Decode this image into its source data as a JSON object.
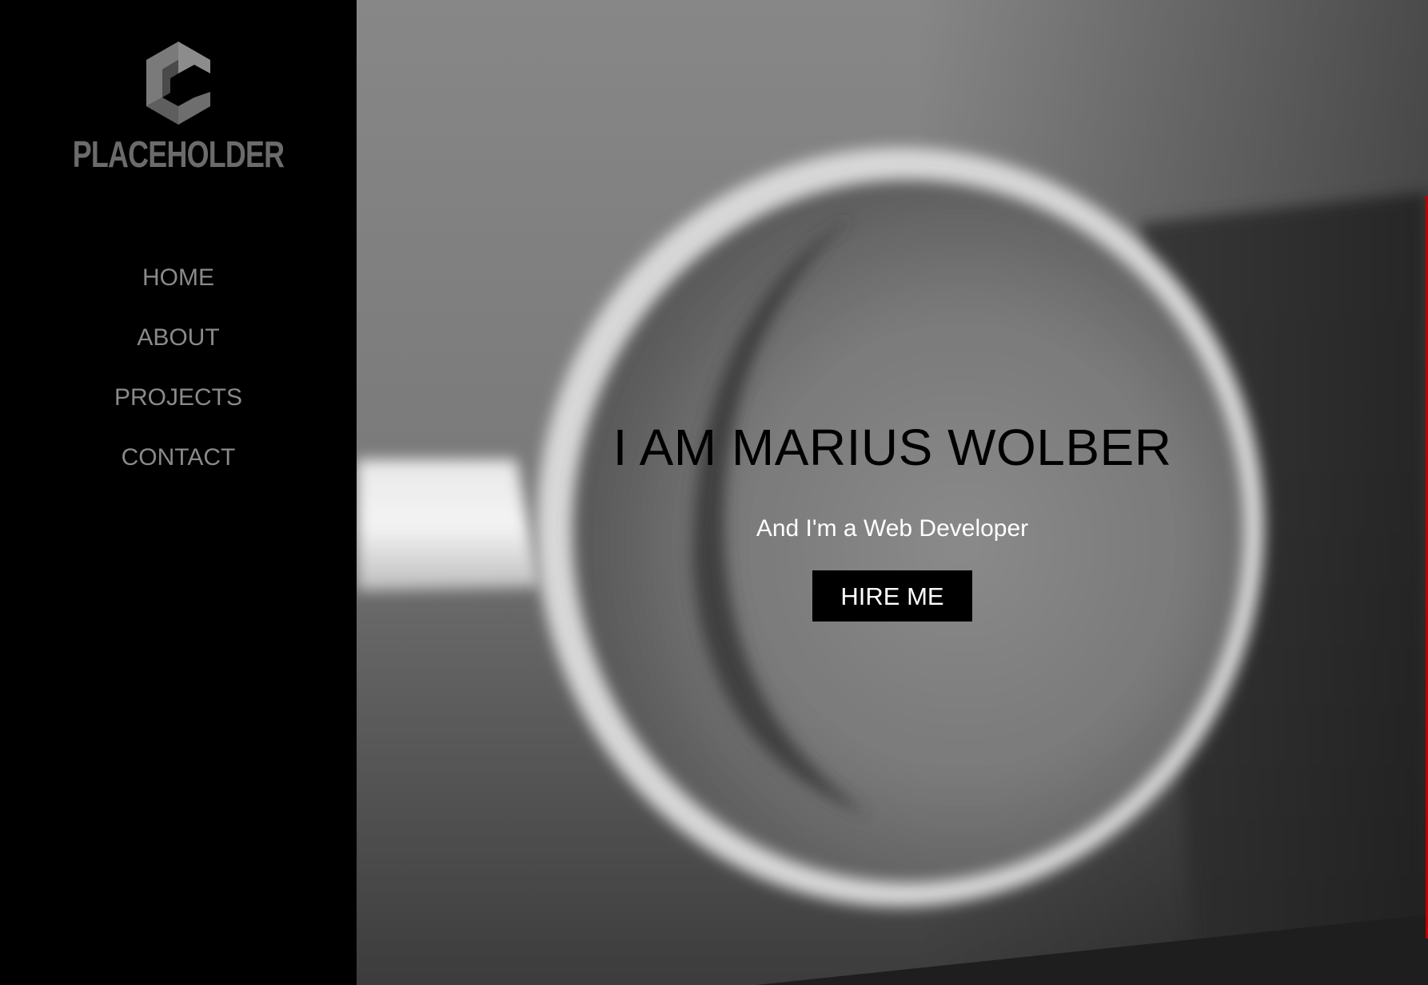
{
  "logo": {
    "text": "PLACEHOLDER"
  },
  "nav": {
    "items": [
      {
        "label": "HOME"
      },
      {
        "label": "ABOUT"
      },
      {
        "label": "PROJECTS"
      },
      {
        "label": "CONTACT"
      }
    ]
  },
  "hero": {
    "title": "I AM MARIUS WOLBER",
    "subtitle": "And I'm a Web Developer",
    "button_label": "HIRE ME"
  },
  "colors": {
    "sidebar_bg": "#000000",
    "nav_text": "#8a8a8a",
    "logo": "#6b6b6b",
    "button_bg": "#000000",
    "accent_line": "#bb0000"
  }
}
